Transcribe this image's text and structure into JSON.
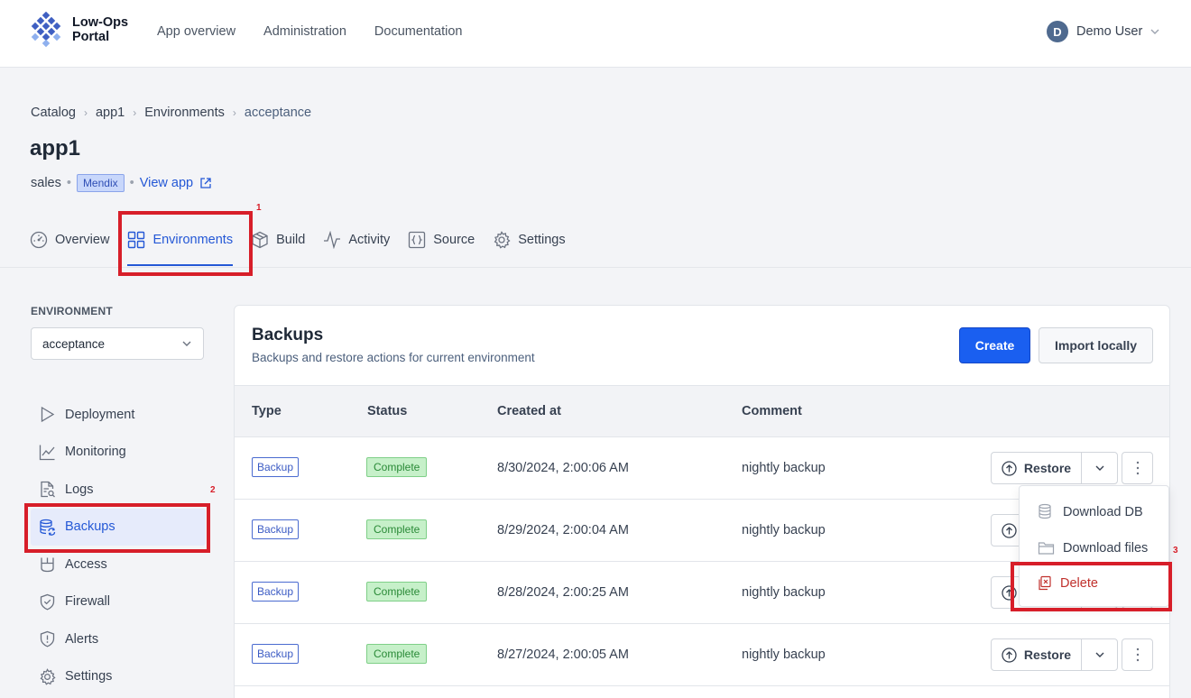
{
  "brand": {
    "line1": "Low-Ops",
    "line2": "Portal"
  },
  "topnav": [
    "App overview",
    "Administration",
    "Documentation"
  ],
  "user": {
    "initial": "D",
    "name": "Demo User"
  },
  "breadcrumb": [
    "Catalog",
    "app1",
    "Environments",
    "acceptance"
  ],
  "page": {
    "title": "app1",
    "team": "sales",
    "platform": "Mendix",
    "view_app": "View app"
  },
  "tabs": [
    {
      "label": "Overview",
      "icon": "dashboard-icon"
    },
    {
      "label": "Environments",
      "icon": "grid-icon",
      "active": true
    },
    {
      "label": "Build",
      "icon": "box-icon"
    },
    {
      "label": "Activity",
      "icon": "activity-icon"
    },
    {
      "label": "Source",
      "icon": "braces-icon"
    },
    {
      "label": "Settings",
      "icon": "gear-icon"
    }
  ],
  "annotations": [
    "1",
    "2",
    "3"
  ],
  "sidebar": {
    "env_label": "ENVIRONMENT",
    "env_value": "acceptance",
    "items": [
      {
        "label": "Deployment",
        "icon": "play-icon"
      },
      {
        "label": "Monitoring",
        "icon": "chart-icon"
      },
      {
        "label": "Logs",
        "icon": "log-file-icon"
      },
      {
        "label": "Backups",
        "icon": "database-icon",
        "active": true
      },
      {
        "label": "Access",
        "icon": "door-icon"
      },
      {
        "label": "Firewall",
        "icon": "shield-icon"
      },
      {
        "label": "Alerts",
        "icon": "alert-icon"
      },
      {
        "label": "Settings",
        "icon": "gear-icon"
      }
    ]
  },
  "backups": {
    "title": "Backups",
    "subtitle": "Backups and restore actions for current environment",
    "create_label": "Create",
    "import_label": "Import locally",
    "columns": [
      "Type",
      "Status",
      "Created at",
      "Comment"
    ],
    "rows": [
      {
        "type": "Backup",
        "status": "Complete",
        "created": "8/30/2024, 2:00:06 AM",
        "comment": "nightly backup"
      },
      {
        "type": "Backup",
        "status": "Complete",
        "created": "8/29/2024, 2:00:04 AM",
        "comment": "nightly backup"
      },
      {
        "type": "Backup",
        "status": "Complete",
        "created": "8/28/2024, 2:00:25 AM",
        "comment": "nightly backup"
      },
      {
        "type": "Backup",
        "status": "Complete",
        "created": "8/27/2024, 2:00:05 AM",
        "comment": "nightly backup"
      }
    ],
    "restore_label": "Restore"
  },
  "menu": {
    "download_db": "Download DB",
    "download_files": "Download files",
    "delete": "Delete"
  },
  "colors": {
    "accent": "#1a5ff0",
    "highlight": "#d71e29",
    "danger": "#c0302c"
  }
}
